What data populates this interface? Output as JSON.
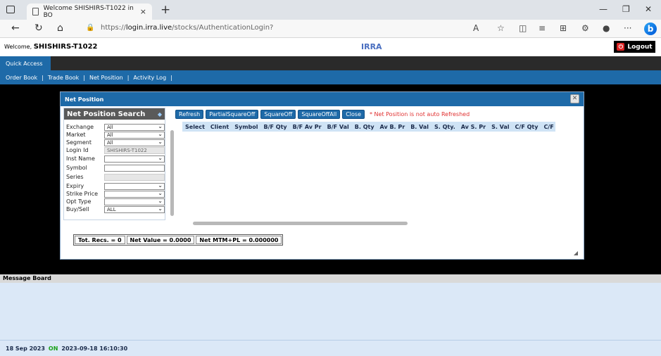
{
  "browser": {
    "tab_title": "Welcome SHISHIRS-T1022 in BO",
    "url_host": "login.irra.live",
    "url_prefix": "https://",
    "url_path": "/stocks/AuthenticationLogin?"
  },
  "header": {
    "welcome_label": "Welcome,",
    "username": "SHISHIRS-T1022",
    "brand": "IRRA",
    "logout_label": "Logout"
  },
  "quick_access": "Quick Access",
  "nav": {
    "items": [
      "Order Book",
      "Trade Book",
      "Net Position",
      "Activity Log"
    ]
  },
  "dialog": {
    "title": "Net Position",
    "search": {
      "title": "Net Position Search",
      "fields": [
        {
          "label": "Exchange",
          "value": "All"
        },
        {
          "label": "Market",
          "value": "All"
        },
        {
          "label": "Segment",
          "value": "All"
        },
        {
          "label": "Login Id",
          "value": "SHISHIRS-T1022"
        },
        {
          "label": "Inst Name",
          "value": ""
        },
        {
          "label": "Symbol",
          "value": ""
        },
        {
          "label": "Series",
          "value": ""
        },
        {
          "label": "Expiry",
          "value": ""
        },
        {
          "label": "Strike Price",
          "value": ""
        },
        {
          "label": "Opt Type",
          "value": ""
        },
        {
          "label": "Buy/Sell",
          "value": "ALL"
        }
      ]
    },
    "buttons": {
      "refresh": "Refresh",
      "partial": "PartialSquareOff",
      "squareoff": "SquareOff",
      "squareoffall": "SquareOffAll",
      "close": "Close"
    },
    "note": "* Net Position is not auto Refreshed",
    "columns": [
      "Select",
      "Client",
      "Symbol",
      "B/F Qty",
      "B/F Av Pr",
      "B/F Val",
      "B. Qty",
      "Av B. Pr",
      "B. Val",
      "S. Qty.",
      "Av S. Pr",
      "S. Val",
      "C/F Qty",
      "C/F A"
    ],
    "totals": {
      "recs": "Tot. Recs. = 0",
      "net_value": "Net Value = 0.0000",
      "mtm": "Net MTM+PL = 0.000000"
    }
  },
  "message_board": "Message Board",
  "status": {
    "date": "18 Sep 2023",
    "state": "ON",
    "datetime": "2023-09-18 16:10:30"
  }
}
